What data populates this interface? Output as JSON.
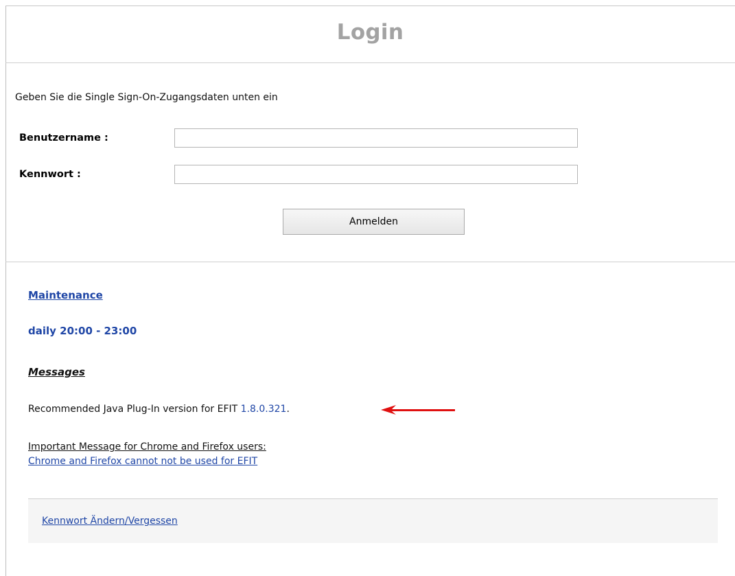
{
  "header": {
    "title": "Login"
  },
  "form": {
    "intro": "Geben Sie die Single Sign-On-Zugangsdaten unten ein",
    "username_label": "Benutzername :",
    "username_value": "",
    "password_label": "Kennwort :",
    "password_value": "",
    "submit_label": "Anmelden"
  },
  "info": {
    "maintenance_link": "Maintenance",
    "maintenance_time": "daily 20:00 - 23:00",
    "messages_heading": "Messages",
    "java_text": "Recommended Java Plug-In version for EFIT ",
    "java_version": "1.8.0.321",
    "java_suffix": ".",
    "important_text": "Important Message for Chrome and Firefox users:",
    "chrome_link": "Chrome and Firefox cannot not be used for EFIT"
  },
  "footer": {
    "password_link": "Kennwort Ändern/Vergessen"
  },
  "colors": {
    "link_blue": "#1f46a6",
    "title_gray": "#a3a3a3",
    "arrow_red": "#e01010"
  }
}
